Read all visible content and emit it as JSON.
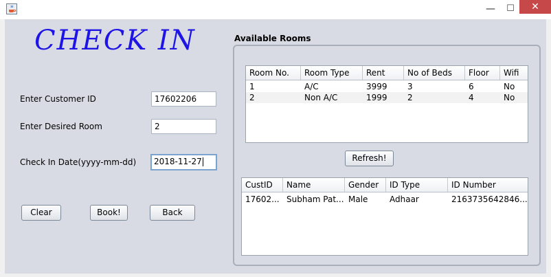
{
  "window": {
    "icon": "java-coffee-icon",
    "minimize_glyph": "—",
    "maximize_glyph": "☐",
    "close_glyph": "✕"
  },
  "form": {
    "heading": "CHECK IN",
    "customer_id_label": "Enter Customer ID",
    "customer_id_value": "17602206",
    "room_label": "Enter Desired Room",
    "room_value": "2",
    "date_label": "Check In Date(yyyy-mm-dd)",
    "date_value": "2018-11-27"
  },
  "buttons": {
    "clear": "Clear",
    "book": "Book!",
    "back": "Back",
    "refresh": "Refresh!"
  },
  "rooms": {
    "group_title": "Available Rooms",
    "columns": [
      "Room No.",
      "Room Type",
      "Rent",
      "No of Beds",
      "Floor",
      "Wifi"
    ],
    "rows": [
      [
        "1",
        "A/C",
        "3999",
        "3",
        "6",
        "No"
      ],
      [
        "2",
        "Non A/C",
        "1999",
        "2",
        "4",
        "No"
      ]
    ]
  },
  "customers": {
    "columns": [
      "CustID",
      "Name",
      "Gender",
      "ID Type",
      "ID Number"
    ],
    "rows": [
      [
        "17602...",
        "Subham Pat...",
        "Male",
        "Adhaar",
        "2163735642846..."
      ]
    ]
  },
  "colors": {
    "heading": "#1e14e6",
    "close_button": "#c74848",
    "panel_background": "#d8dbe3"
  }
}
